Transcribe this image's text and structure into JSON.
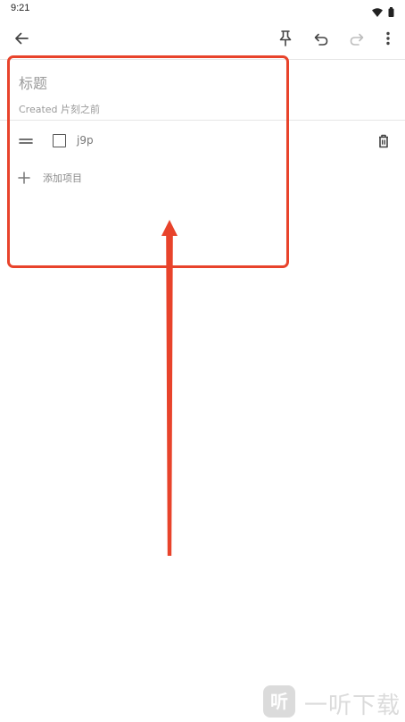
{
  "status_bar": {
    "time": "9:21",
    "icons": [
      "wifi-icon",
      "battery-icon"
    ]
  },
  "toolbar": {
    "icons": [
      "back-arrow-icon",
      "pin-icon",
      "undo-icon",
      "redo-icon",
      "more-vert-icon"
    ]
  },
  "note": {
    "title_placeholder": "标题",
    "created_text": "Created 片刻之前"
  },
  "checklist": {
    "items": [
      {
        "text": "j9p",
        "checked": false
      }
    ],
    "add_item_label": "添加项目"
  },
  "annotation": {
    "color": "#e8432b"
  },
  "watermark": {
    "logo_char": "听",
    "text": "一听下载"
  }
}
